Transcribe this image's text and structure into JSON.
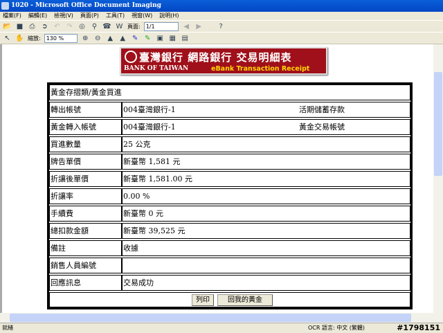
{
  "window": {
    "title": "1020 - Microsoft Office Document Imaging"
  },
  "menu": [
    "檔案(F)",
    "編輯(E)",
    "檢視(V)",
    "頁面(P)",
    "工具(T)",
    "視窗(W)",
    "說明(H)"
  ],
  "toolbar": {
    "page_label": "頁面:",
    "page_value": "1/1",
    "zoom_label": "縮放:",
    "zoom_value": "130 %"
  },
  "logo": {
    "zh": "臺灣銀行 網路銀行 交易明細表",
    "en_bank": "BANK OF TAIWAN",
    "en_title": "eBank Transaction Receipt"
  },
  "receipt": {
    "header": "黃金存摺類/黃金買進",
    "rows": [
      {
        "label": "轉出帳號",
        "value": "004臺灣銀行-1",
        "value2": "活期儲蓄存款"
      },
      {
        "label": "黃金轉入帳號",
        "value": "004臺灣銀行-1",
        "value2": "黃金交易帳號"
      },
      {
        "label": "買進數量",
        "value": "25 公克"
      },
      {
        "label": "牌告單價",
        "value": "新臺幣 1,581 元"
      },
      {
        "label": "折讓後單價",
        "value": "新臺幣 1,581.00 元"
      },
      {
        "label": "折讓率",
        "value": "0.00 %"
      },
      {
        "label": "手續費",
        "value": "新臺幣 0 元"
      },
      {
        "label": "總扣款金額",
        "value": "新臺幣 39,525 元"
      },
      {
        "label": "備註",
        "value": "收據"
      },
      {
        "label": "銷售人員編號",
        "value": ""
      },
      {
        "label": "回應訊息",
        "value": "交易成功"
      }
    ],
    "print_button": "列印",
    "back_button": "回我的黃金"
  },
  "status": {
    "left": "就緒",
    "ocr": "OCR 語言: 中文 (繁體)",
    "id": "#1798151"
  }
}
